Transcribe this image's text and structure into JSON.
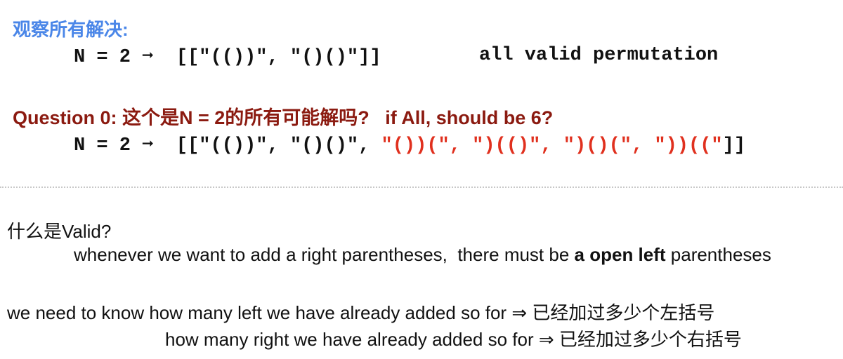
{
  "section1": {
    "heading": "观察所有解决:",
    "expr": "N = 2 ➞  [[\"(())\", \"()()\"]]",
    "note": "all valid permutation"
  },
  "section2": {
    "heading": "Question 0: 这个是N = 2的所有可能解吗?   if All, should be 6?",
    "expr_prefix": "N = 2 ➞  [[\"(())\", \"()()\", ",
    "expr_extra": "\"())(\", \")(()\", \")()(\", \"))((\"",
    "expr_suffix": "]]"
  },
  "notes": {
    "valid_question": "什么是Valid?",
    "valid_def_before": "whenever we want to add a right parentheses,  there must be ",
    "valid_def_bold": "a open left",
    "valid_def_after": " parentheses",
    "need_left": "we need to know how many left we have already added so for ⇒ 已经加过多少个左括号",
    "need_right": "how many right we have already added so for ⇒ 已经加过多少个右括号"
  },
  "colors": {
    "heading_blue": "#4a86e8",
    "heading_red": "#8b1a10",
    "highlight_red": "#e0301e"
  }
}
